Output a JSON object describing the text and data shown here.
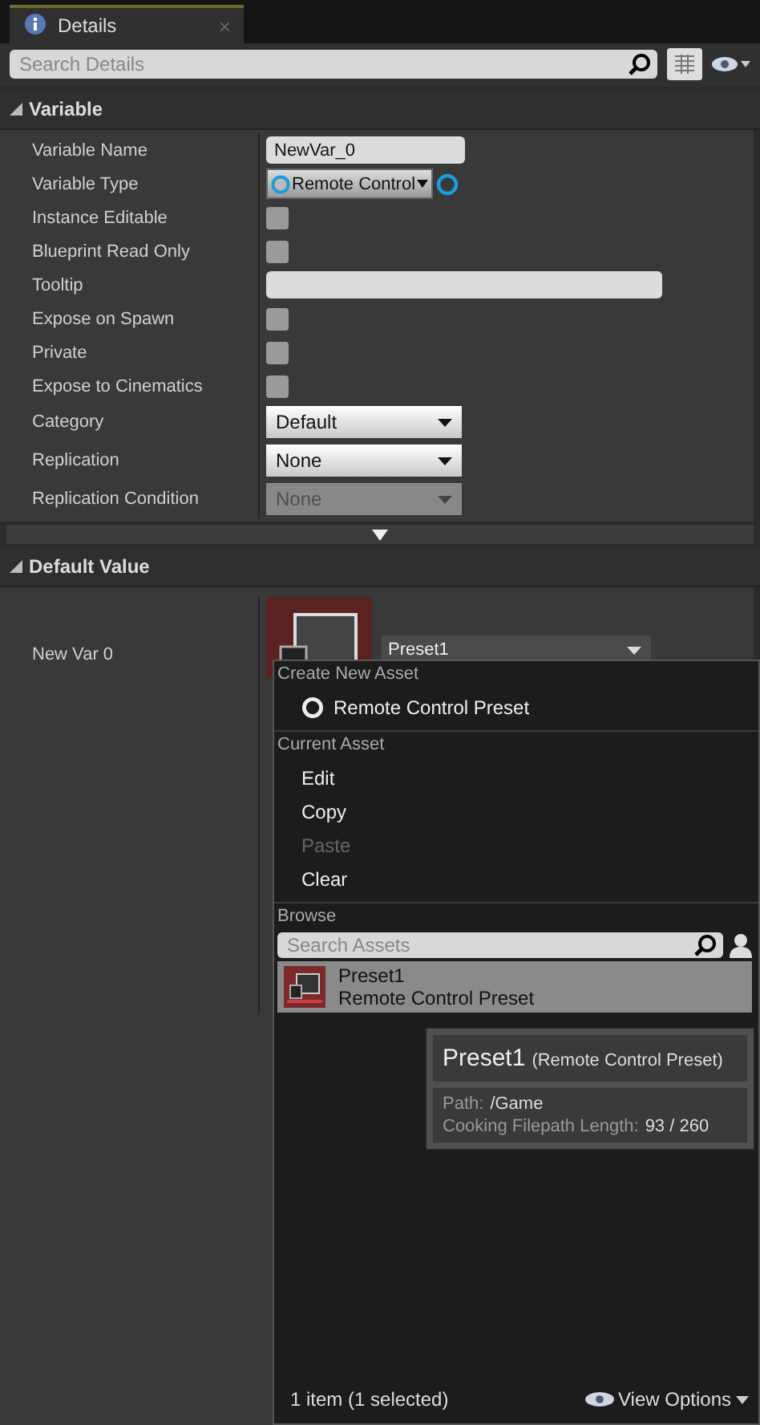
{
  "tab": {
    "title": "Details",
    "close": "×"
  },
  "search": {
    "placeholder": "Search Details"
  },
  "sections": [
    {
      "title": "Variable",
      "expanded": true,
      "rows": [
        {
          "kind": "text",
          "label": "Variable Name",
          "value": "NewVar_0"
        },
        {
          "kind": "type",
          "label": "Variable Type",
          "value": "Remote Control"
        },
        {
          "kind": "checkbox",
          "label": "Instance Editable",
          "checked": false
        },
        {
          "kind": "checkbox",
          "label": "Blueprint Read Only",
          "checked": false
        },
        {
          "kind": "text",
          "label": "Tooltip",
          "value": "",
          "wide": true
        },
        {
          "kind": "checkbox",
          "label": "Expose on Spawn",
          "checked": false
        },
        {
          "kind": "checkbox",
          "label": "Private",
          "checked": false
        },
        {
          "kind": "checkbox",
          "label": "Expose to Cinematics",
          "checked": false
        },
        {
          "kind": "combo",
          "label": "Category",
          "value": "Default",
          "disabled": false
        },
        {
          "kind": "combo",
          "label": "Replication",
          "value": "None",
          "disabled": false
        },
        {
          "kind": "combo",
          "label": "Replication Condition",
          "value": "None",
          "disabled": true
        }
      ],
      "more": true
    },
    {
      "title": "Default Value",
      "expanded": true,
      "rows": [
        {
          "kind": "asset",
          "label": "New Var 0",
          "value": "Preset1"
        }
      ],
      "more": false
    }
  ],
  "menu": {
    "sections": [
      {
        "header": "Create New Asset",
        "items": [
          {
            "label": "Remote Control Preset",
            "icon": true,
            "disabled": false
          }
        ]
      },
      {
        "header": "Current Asset",
        "items": [
          {
            "label": "Edit",
            "disabled": false
          },
          {
            "label": "Copy",
            "disabled": false
          },
          {
            "label": "Paste",
            "disabled": true
          },
          {
            "label": "Clear",
            "disabled": false
          }
        ]
      }
    ],
    "browse": {
      "header": "Browse",
      "placeholder": "Search Assets",
      "assets": [
        {
          "name": "Preset1",
          "type": "Remote Control Preset",
          "selected": true
        }
      ]
    },
    "tooltip": {
      "name": "Preset1",
      "type": "(Remote Control Preset)",
      "details": [
        {
          "label": "Path:",
          "value": "/Game"
        },
        {
          "label": "Cooking Filepath Length:",
          "value": "93 / 260"
        }
      ]
    },
    "footer": {
      "count": "1 item (1 selected)",
      "view_options": "View Options"
    }
  }
}
